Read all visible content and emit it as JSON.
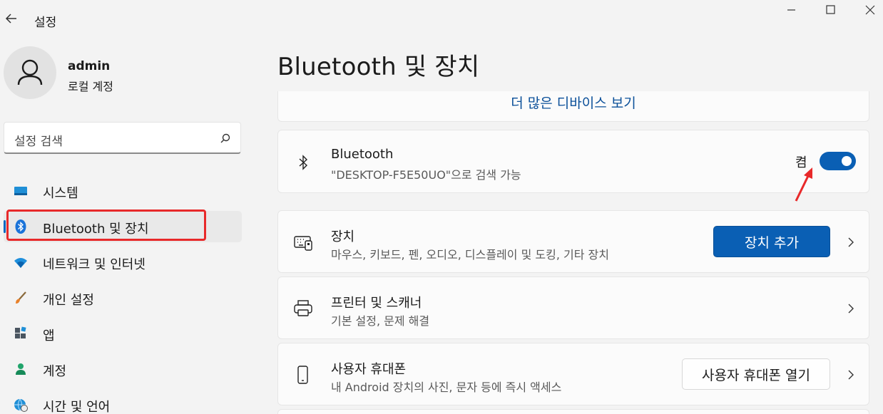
{
  "window": {
    "title": "설정",
    "controls": {
      "minimize": "minimize-icon",
      "maximize": "maximize-icon",
      "close": "close-icon"
    }
  },
  "user": {
    "name": "admin",
    "account_type": "로컬 계정"
  },
  "search": {
    "placeholder": "설정 검색"
  },
  "sidebar": {
    "items": [
      {
        "label": "시스템",
        "icon": "system-icon",
        "active": false
      },
      {
        "label": "Bluetooth 및 장치",
        "icon": "bluetooth-icon",
        "active": true
      },
      {
        "label": "네트워크 및 인터넷",
        "icon": "wifi-icon",
        "active": false
      },
      {
        "label": "개인 설정",
        "icon": "brush-icon",
        "active": false
      },
      {
        "label": "앱",
        "icon": "apps-icon",
        "active": false
      },
      {
        "label": "계정",
        "icon": "account-icon",
        "active": false
      },
      {
        "label": "시간 및 언어",
        "icon": "globe-clock-icon",
        "active": false
      }
    ]
  },
  "main": {
    "title": "Bluetooth 및 장치",
    "more_devices": "더 많은 디바이스 보기",
    "bluetooth": {
      "title": "Bluetooth",
      "subtitle": "\"DESKTOP-F5E50UO\"으로 검색 가능",
      "state_label": "켬",
      "on": true
    },
    "devices": {
      "title": "장치",
      "subtitle": "마우스, 키보드, 펜, 오디오, 디스플레이 및 도킹, 기타 장치",
      "button": "장치 추가"
    },
    "printers": {
      "title": "프린터 및 스캐너",
      "subtitle": "기본 설정, 문제 해결"
    },
    "phone": {
      "title": "사용자 휴대폰",
      "subtitle": "내 Android 장치의 사진, 문자 등에 즉시 액세스",
      "button": "사용자 휴대폰 열기"
    }
  },
  "colors": {
    "accent": "#0a5fb4",
    "link": "#0a4f99",
    "annotation": "#e8292a"
  }
}
